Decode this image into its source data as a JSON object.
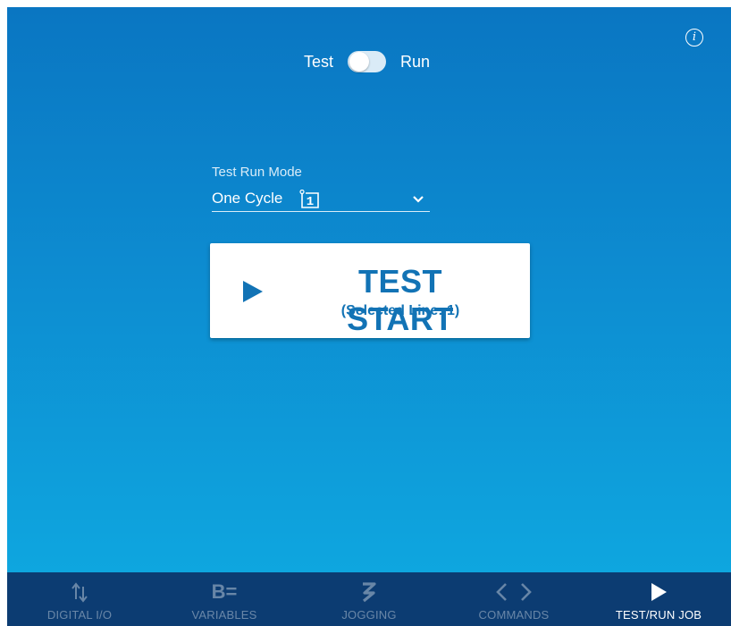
{
  "info": {
    "glyph": "i"
  },
  "mode_toggle": {
    "left_label": "Test",
    "right_label": "Run",
    "state": "Test"
  },
  "test_run_mode": {
    "label": "Test Run Mode",
    "value": "One Cycle",
    "cycle_badge": "1"
  },
  "start_button": {
    "title": "TEST START",
    "subtitle": "(Selected Line: 1)"
  },
  "bottom_nav": {
    "items": [
      {
        "label": "DIGITAL I/O",
        "icon": "arrows-up-down-icon"
      },
      {
        "label": "VARIABLES",
        "icon_text": "B="
      },
      {
        "label": "JOGGING",
        "icon": "jogging-icon"
      },
      {
        "label": "COMMANDS",
        "icon": "code-brackets-icon"
      },
      {
        "label": "TEST/RUN JOB",
        "icon": "play-icon",
        "active": true
      }
    ]
  },
  "colors": {
    "gradient_top": "#0a76c2",
    "gradient_bottom": "#0ea6df",
    "nav_background": "#0c3c72",
    "accent_text": "#1273b5"
  }
}
